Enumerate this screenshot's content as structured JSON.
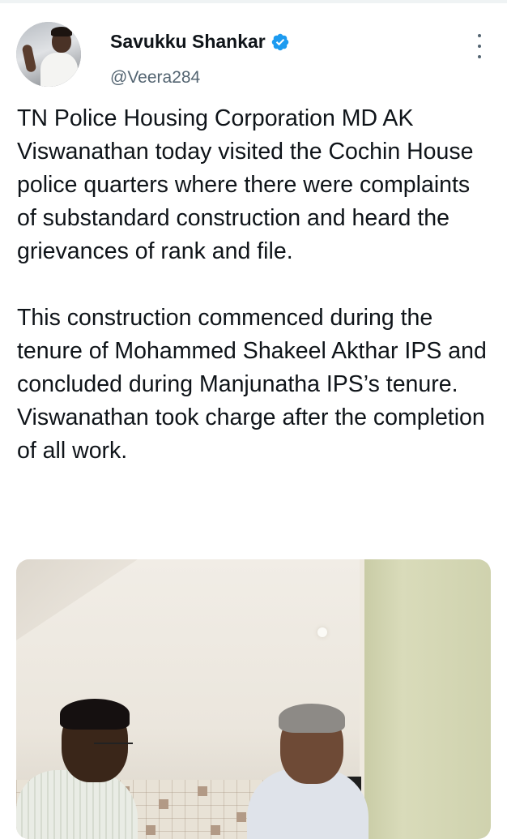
{
  "author": {
    "name": "Savukku Shankar",
    "handle": "@Veera284",
    "verified": true
  },
  "icons": {
    "verified": "verified-badge-icon",
    "more": "more-vertical-icon"
  },
  "tweet": {
    "paragraphs": [
      "TN Police Housing Corporation MD AK Viswanathan today visited the Cochin House police quarters where there were complaints of substandard construction and heard the grievances of rank and file.",
      "This construction commenced during the tenure of Mohammed Shakeel Akthar IPS and concluded during Manjunatha IPS’s tenure.  Viswanathan took charge after the completion of all work."
    ]
  },
  "colors": {
    "text": "#0f1419",
    "secondary": "#536471",
    "verified": "#1d9bf0"
  }
}
